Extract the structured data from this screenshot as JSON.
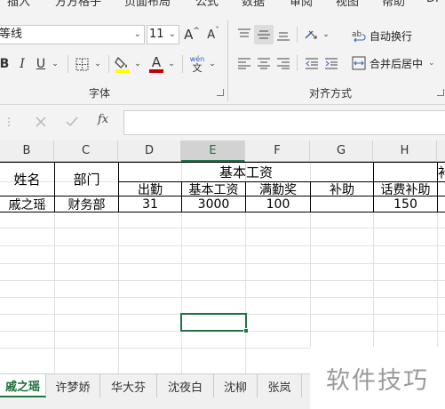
{
  "ribbon": {
    "tabs": [
      "插入",
      "方方格子",
      "页面布局",
      "公式",
      "数据",
      "审阅",
      "视图",
      "帮助",
      "DI"
    ],
    "font_name": "等线",
    "font_size": "11",
    "grow_font_label": "A",
    "shrink_font_label": "A",
    "bold_label": "B",
    "italic_label": "I",
    "underline_label": "U",
    "font_color_label": "A",
    "phonetic_top": "wén",
    "phonetic_bottom": "文",
    "wrap_text_label": "自动换行",
    "merge_center_label": "合并后居中",
    "font_group_label": "字体",
    "align_group_label": "对齐方式",
    "colors": {
      "highlight": "#ffff00",
      "font_color": "#c00000",
      "accent": "#217346"
    }
  },
  "formula_bar": {
    "cancel_icon": "close-icon",
    "enter_icon": "check-icon",
    "fx_label": "fx",
    "value": ""
  },
  "grid": {
    "columns": [
      "B",
      "C",
      "D",
      "E",
      "F",
      "G",
      "H"
    ],
    "selected_column": "E",
    "headers": {
      "name": "姓名",
      "dept": "部门",
      "basic_group": "基本工资",
      "attendance": "出勤",
      "base_salary": "基本工资",
      "full_bonus": "满勤奖",
      "subsidy": "补助",
      "phone_subsidy": "话费补助",
      "next_col_partial": "补"
    },
    "row": {
      "name": "戚之瑶",
      "dept": "财务部",
      "attendance": "31",
      "base_salary": "3000",
      "full_bonus": "100",
      "subsidy": "",
      "phone_subsidy": "150"
    }
  },
  "sheets": [
    "戚之瑶",
    "许梦娇",
    "华大芬",
    "沈夜白",
    "沈柳",
    "张岚"
  ],
  "active_sheet": "戚之瑶",
  "watermark": "软件技巧"
}
